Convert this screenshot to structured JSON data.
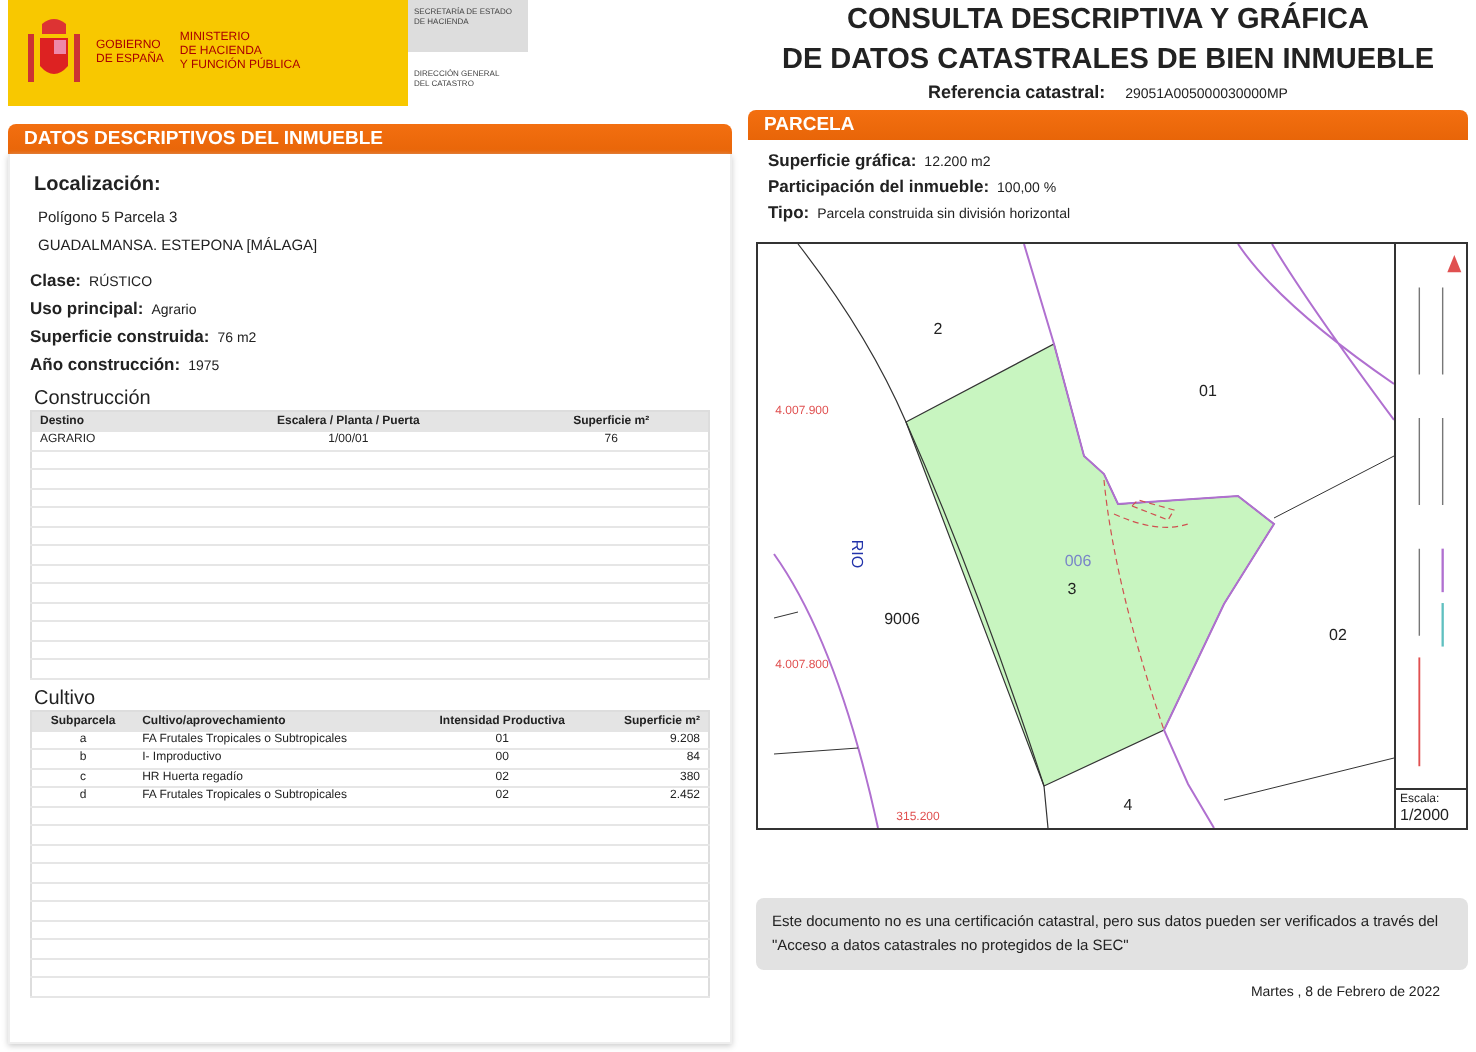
{
  "header": {
    "government": "GOBIERNO\nDE ESPAÑA",
    "ministry": "MINISTERIO\nDE HACIENDA\nY FUNCIÓN PÚBLICA",
    "secretariat": "SECRETARÍA DE ESTADO\nDE HACIENDA",
    "directorate": "DIRECCIÓN GENERAL\nDEL CATASTRO"
  },
  "title": {
    "lines": [
      "CONSULTA DESCRIPTIVA Y GRÁFICA",
      "DE DATOS CATASTRALES DE BIEN INMUEBLE"
    ],
    "reference_label": "Referencia catastral:",
    "reference": "29051A005000030000MP"
  },
  "descriptive": {
    "heading": "DATOS DESCRIPTIVOS DEL INMUEBLE",
    "location_label": "Localización:",
    "location_lines": [
      "Polígono 5 Parcela 3",
      "GUADALMANSA. ESTEPONA [MÁLAGA]"
    ],
    "fields": [
      {
        "label": "Clase:",
        "value": "RÚSTICO"
      },
      {
        "label": "Uso principal:",
        "value": "Agrario"
      },
      {
        "label": "Superficie construida:",
        "value": "76 m2"
      },
      {
        "label": "Año construcción:",
        "value": "1975"
      }
    ],
    "construction": {
      "heading": "Construcción",
      "columns": [
        "Destino",
        "Escalera / Planta / Puerta",
        "Superficie m²"
      ],
      "rows": [
        [
          "AGRARIO",
          "1/00/01",
          "76"
        ]
      ]
    },
    "crops": {
      "heading": "Cultivo",
      "columns": [
        "Subparcela",
        "Cultivo/aprovechamiento",
        "Intensidad Productiva",
        "Superficie m²"
      ],
      "rows": [
        [
          "a",
          "FA Frutales Tropicales o Subtropicales",
          "01",
          "9.208"
        ],
        [
          "b",
          "I- Improductivo",
          "00",
          "84"
        ],
        [
          "c",
          "HR Huerta regadío",
          "02",
          "380"
        ],
        [
          "d",
          "FA Frutales Tropicales o Subtropicales",
          "02",
          "2.452"
        ]
      ]
    }
  },
  "parcel": {
    "heading": "PARCELA",
    "fields": [
      {
        "label": "Superficie gráfica:",
        "value": "12.200 m2"
      },
      {
        "label": "Participación del inmueble:",
        "value": "100,00 %"
      },
      {
        "label": "Tipo:",
        "value": "Parcela construida sin división horizontal"
      }
    ],
    "map": {
      "labels": [
        {
          "text": "2",
          "kind": "parcel"
        },
        {
          "text": "01",
          "kind": "parcel"
        },
        {
          "text": "3",
          "kind": "parcel"
        },
        {
          "text": "9006",
          "kind": "parcel"
        },
        {
          "text": "02",
          "kind": "parcel"
        },
        {
          "text": "4",
          "kind": "parcel"
        },
        {
          "text": "006",
          "kind": "building"
        },
        {
          "text": "RIO",
          "kind": "river"
        },
        {
          "text": "4.007.900",
          "kind": "coordinate"
        },
        {
          "text": "4.007.800",
          "kind": "coordinate"
        },
        {
          "text": "315.200",
          "kind": "coordinate"
        }
      ],
      "scale_label": "Escala:",
      "scale": "1/2000"
    }
  },
  "notice": "Este documento no es una certificación catastral, pero sus datos pueden ser verificados a través del \"Acceso a datos catastrales no protegidos de la SEC\"",
  "date": "Martes , 8 de Febrero de 2022"
}
